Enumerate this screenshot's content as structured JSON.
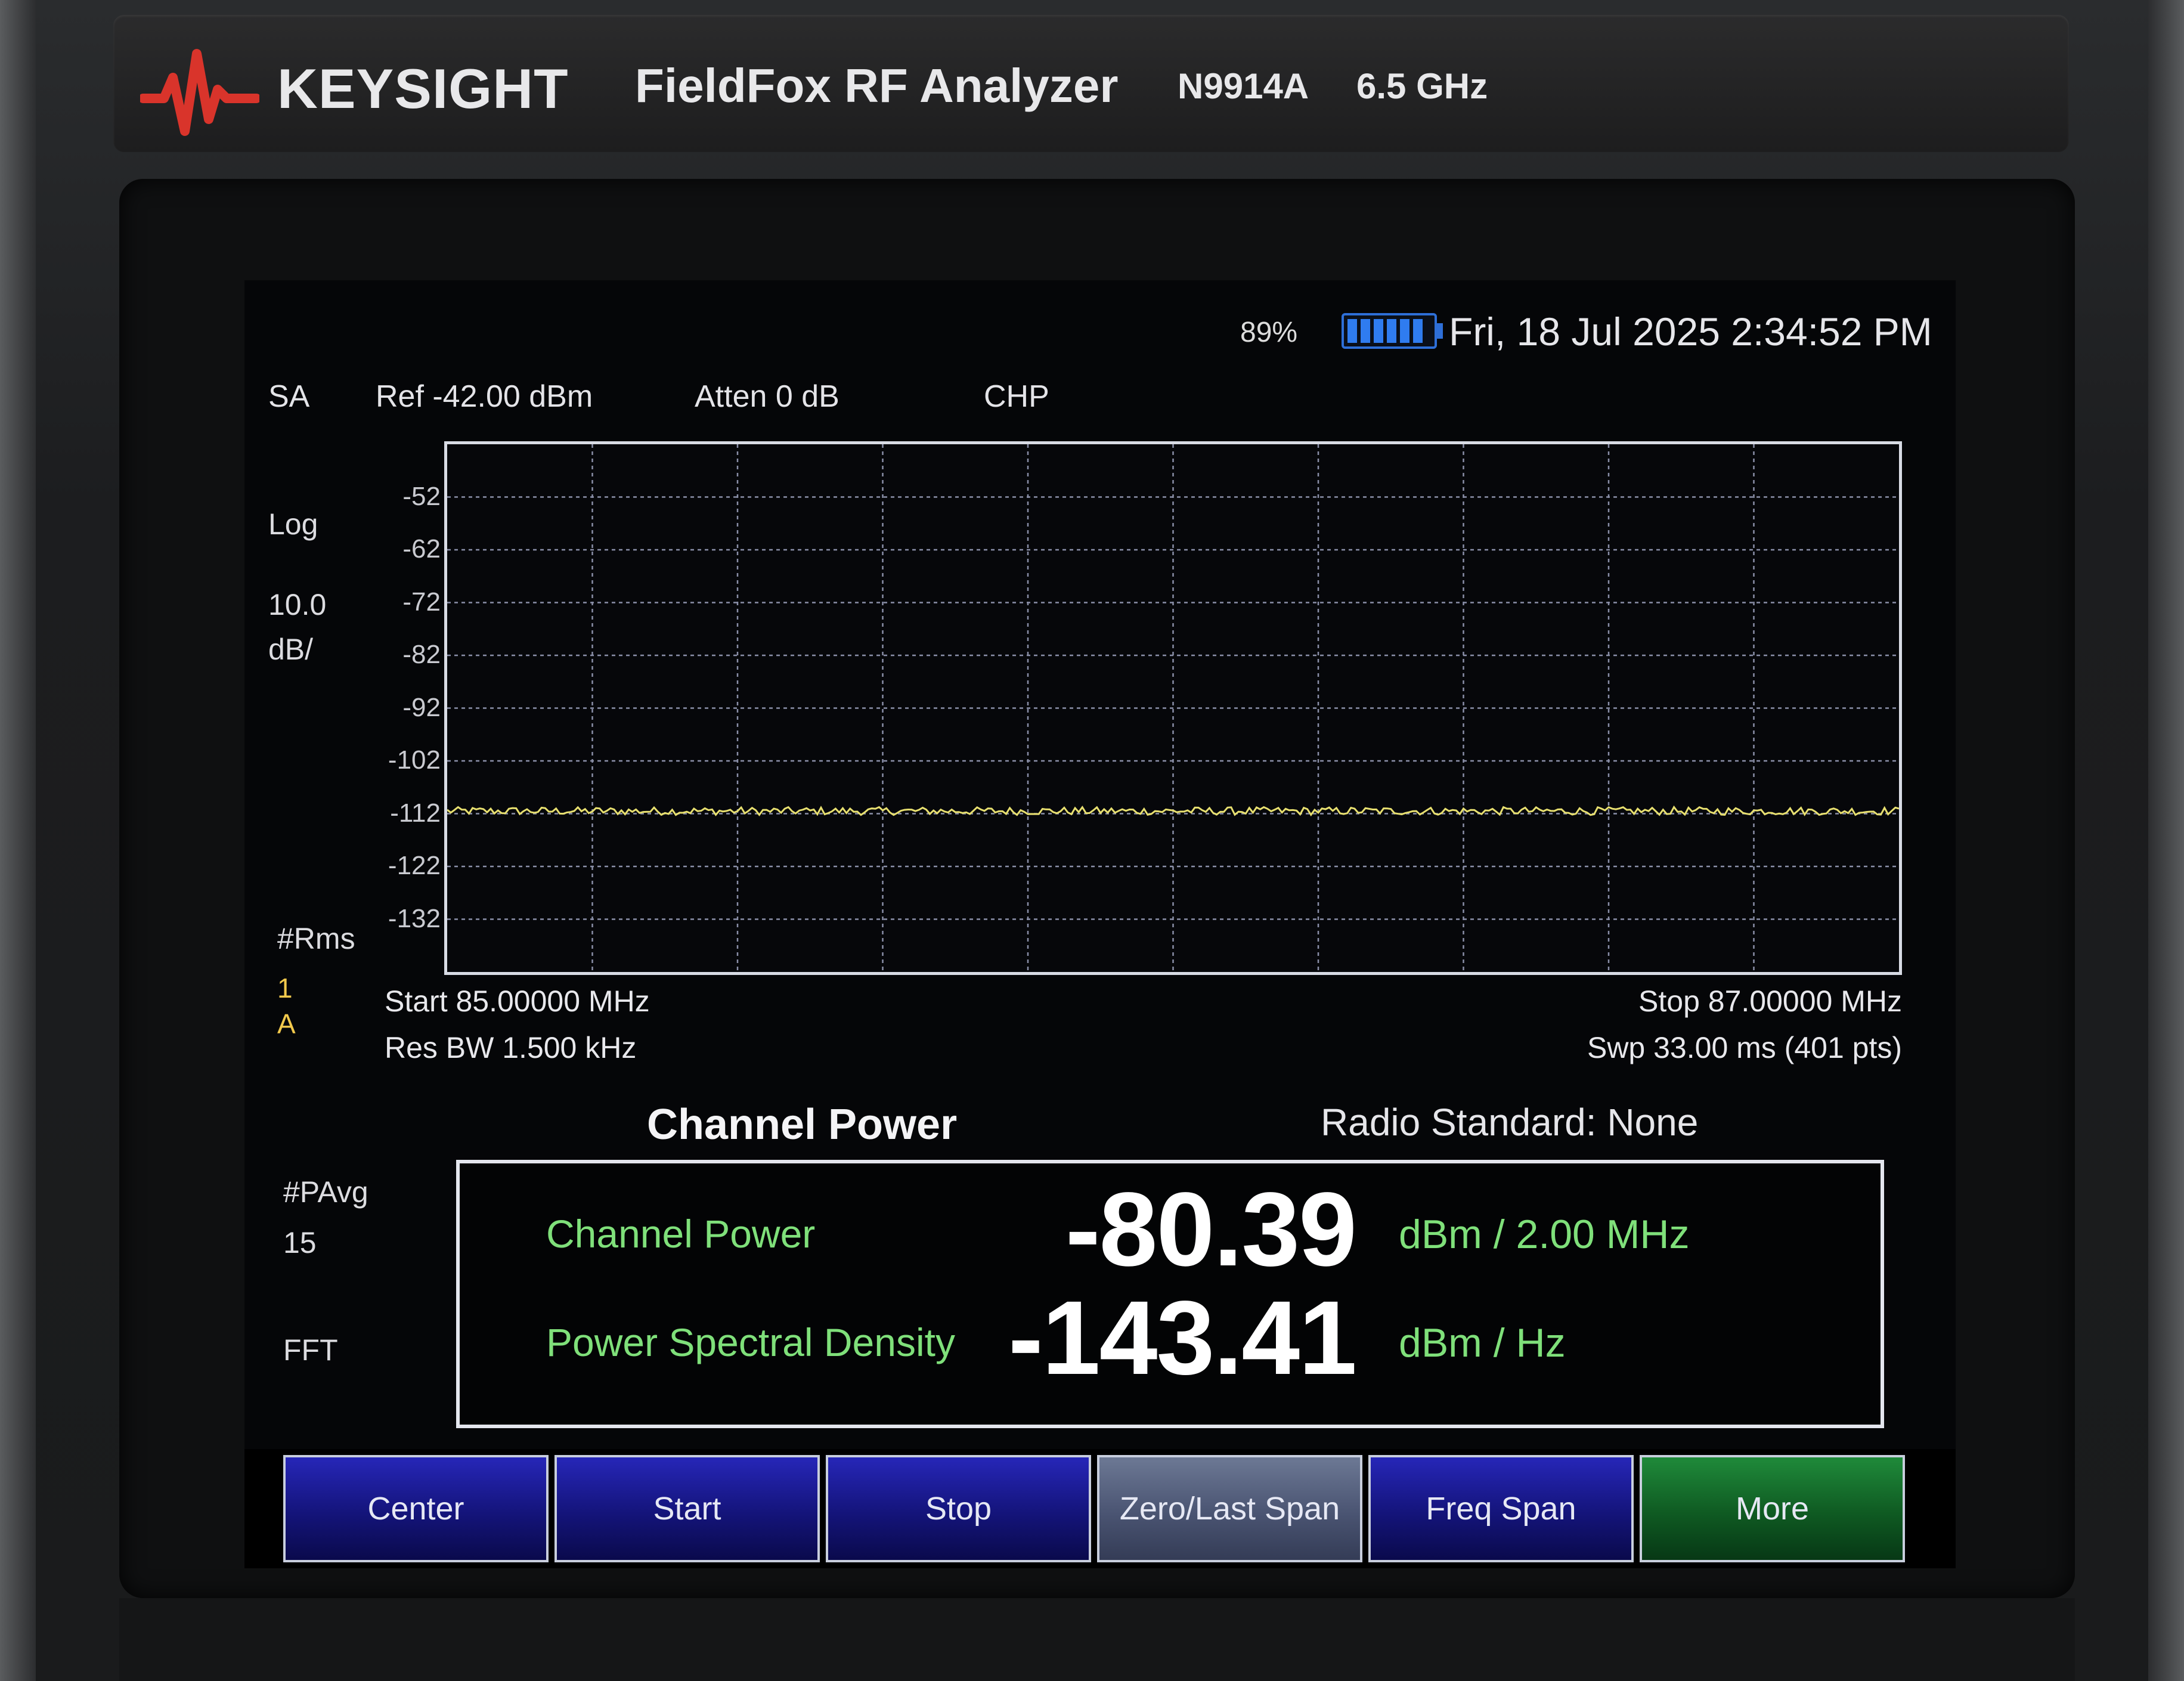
{
  "device": {
    "brand": "KEYSIGHT",
    "product": "FieldFox RF Analyzer",
    "model": "N9914A",
    "freq_range": "6.5 GHz",
    "logo_icon": "keysight-wave-icon",
    "logo_color": "#d9342b"
  },
  "status": {
    "battery_percent_text": "89%",
    "battery_level": 0.89,
    "datetime": "Fri, 18 Jul 2025 2:34:52 PM"
  },
  "header": {
    "mode": "SA",
    "ref": "Ref -42.00 dBm",
    "atten": "Atten 0 dB",
    "meas": "CHP"
  },
  "sidebar": {
    "scale_type": "Log",
    "scale_value": "10.0",
    "scale_unit": "dB/",
    "rms_label": "#Rms",
    "trace_num": "1",
    "trace_letter": "A",
    "pavg_label": "#PAvg",
    "pavg_value": "15",
    "fft_label": "FFT"
  },
  "chart_data": {
    "type": "line",
    "title": "",
    "xlabel": "",
    "ylabel": "",
    "x_range_mhz": [
      85.0,
      87.0
    ],
    "ylim": [
      -142,
      -42
    ],
    "y_tick_labels": [
      "-52",
      "-62",
      "-72",
      "-82",
      "-92",
      "-102",
      "-112",
      "-122",
      "-132"
    ],
    "grid": true,
    "grid_divisions_x": 10,
    "grid_divisions_y": 10,
    "series": [
      {
        "color": "#e8e070",
        "points": 401,
        "noise_floor_dbm": -111.5,
        "noise_pp_db": 1.5
      }
    ]
  },
  "axis_info": {
    "start": "Start 85.00000 MHz",
    "stop": "Stop 87.00000 MHz",
    "rbw": "Res BW 1.500 kHz",
    "sweep": "Swp 33.00 ms (401 pts)"
  },
  "measurement": {
    "title": "Channel Power",
    "radio_standard": "Radio Standard: None",
    "rows": [
      {
        "label": "Channel Power",
        "value": "-80.39",
        "unit": "dBm / 2.00 MHz"
      },
      {
        "label": "Power Spectral Density",
        "value": "-143.41",
        "unit": "dBm / Hz"
      }
    ]
  },
  "softkeys": [
    {
      "label": "Center",
      "style": "blue"
    },
    {
      "label": "Start",
      "style": "blue"
    },
    {
      "label": "Stop",
      "style": "blue"
    },
    {
      "label": "Zero/Last Span",
      "style": "gray"
    },
    {
      "label": "Freq Span",
      "style": "blue"
    },
    {
      "label": "More",
      "style": "green"
    }
  ]
}
